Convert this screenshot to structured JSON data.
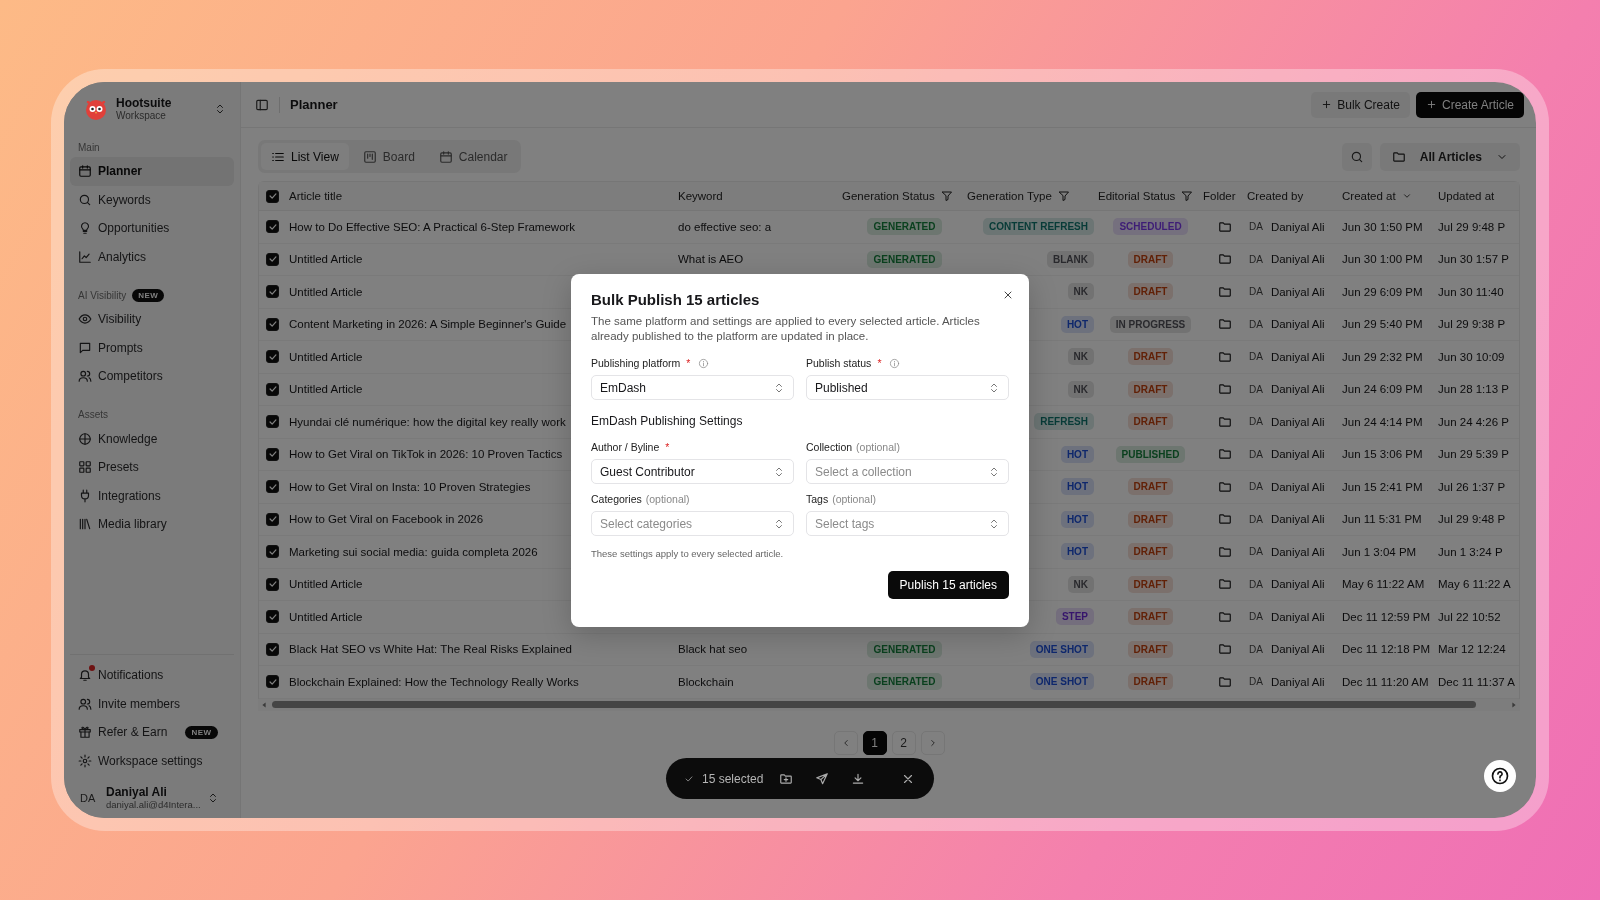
{
  "workspace": {
    "name": "Hootsuite",
    "subtitle": "Workspace"
  },
  "sidebar": {
    "sections": [
      {
        "label": "Main",
        "items": [
          {
            "label": "Planner",
            "selected": true
          },
          {
            "label": "Keywords",
            "selected": false
          },
          {
            "label": "Opportunities",
            "selected": false
          },
          {
            "label": "Analytics",
            "selected": false
          }
        ]
      },
      {
        "label": "AI Visibility",
        "badge": "NEW",
        "items": [
          {
            "label": "Visibility",
            "selected": false
          },
          {
            "label": "Prompts",
            "selected": false
          },
          {
            "label": "Competitors",
            "selected": false
          }
        ]
      },
      {
        "label": "Assets",
        "items": [
          {
            "label": "Knowledge",
            "selected": false
          },
          {
            "label": "Presets",
            "selected": false
          },
          {
            "label": "Integrations",
            "selected": false
          },
          {
            "label": "Media library",
            "selected": false
          }
        ]
      }
    ],
    "footer_items": [
      {
        "label": "Notifications",
        "alert": true
      },
      {
        "label": "Invite members",
        "alert": false
      },
      {
        "label": "Refer & Earn",
        "alert": false,
        "badge": "NEW"
      },
      {
        "label": "Workspace settings",
        "alert": false
      }
    ],
    "user": {
      "initials": "DA",
      "name": "Daniyal Ali",
      "email": "daniyal.ali@d4Intera..."
    }
  },
  "header": {
    "title": "Planner",
    "buttons": [
      {
        "label": "Bulk Create",
        "kind": "secondary"
      },
      {
        "label": "Create Article",
        "kind": "primary"
      }
    ]
  },
  "view_tabs": [
    {
      "label": "List View",
      "selected": true
    },
    {
      "label": "Board",
      "selected": false
    },
    {
      "label": "Calendar",
      "selected": false
    }
  ],
  "folder_filter": {
    "label": "All Articles"
  },
  "table": {
    "all_selected": true,
    "columns": [
      {
        "label": "Article title",
        "kind": "plain"
      },
      {
        "label": "Keyword",
        "kind": "plain"
      },
      {
        "label": "Generation Status",
        "kind": "filter"
      },
      {
        "label": "Generation Type",
        "kind": "filter"
      },
      {
        "label": "Editorial Status",
        "kind": "filter"
      },
      {
        "label": "Folder",
        "kind": "plain"
      },
      {
        "label": "Created by",
        "kind": "plain"
      },
      {
        "label": "Created at",
        "kind": "sort"
      },
      {
        "label": "Updated at",
        "kind": "plain"
      }
    ],
    "rows": [
      {
        "selected": true,
        "title": "How to Do Effective SEO: A Practical 6-Step Framework",
        "keyword": "do effective seo: a",
        "generation_status": {
          "text": "GENERATED",
          "color": "#0a401e"
        },
        "generation_type": {
          "text": "CONTENT REFRESH",
          "color": "#073b37"
        },
        "editorial_status": {
          "text": "SCHEDULED",
          "color": "#3e1d76"
        },
        "creator_initials": "DA",
        "creator": "Daniyal Ali",
        "created_at": "Jun 30 1:50 PM",
        "updated_at": "Jul 29 9:48 P"
      },
      {
        "selected": true,
        "title": "Untitled Article",
        "keyword": "What is AEO",
        "generation_status": {
          "text": "GENERATED",
          "color": "#0a401e"
        },
        "generation_type": {
          "text": "BLANK",
          "color": "#29292d"
        },
        "editorial_status": {
          "text": "DRAFT",
          "color": "#612006"
        },
        "creator_initials": "DA",
        "creator": "Daniyal Ali",
        "created_at": "Jun 30 1:00 PM",
        "updated_at": "Jun 30 1:57 P"
      },
      {
        "selected": true,
        "title": "Untitled Article",
        "generation_type": {
          "text": "NK",
          "color": "#29292d"
        },
        "editorial_status": {
          "text": "DRAFT",
          "color": "#612006"
        },
        "creator_initials": "DA",
        "creator": "Daniyal Ali",
        "created_at": "Jun 29 6:09 PM",
        "updated_at": "Jun 30 11:40"
      },
      {
        "selected": true,
        "title": "Content Marketing in 2026: A Simple Beginner's Guide",
        "generation_type": {
          "text": "HOT",
          "color": "#0e276c"
        },
        "editorial_status": {
          "text": "IN PROGRESS",
          "color": "#29292d"
        },
        "creator_initials": "DA",
        "creator": "Daniyal Ali",
        "created_at": "Jun 29 5:40 PM",
        "updated_at": "Jul 29 9:38 P"
      },
      {
        "selected": true,
        "title": "Untitled Article",
        "generation_type": {
          "text": "NK",
          "color": "#29292d"
        },
        "editorial_status": {
          "text": "DRAFT",
          "color": "#612006"
        },
        "creator_initials": "DA",
        "creator": "Daniyal Ali",
        "created_at": "Jun 29 2:32 PM",
        "updated_at": "Jun 30 10:09"
      },
      {
        "selected": true,
        "title": "Untitled Article",
        "generation_type": {
          "text": "NK",
          "color": "#29292d"
        },
        "editorial_status": {
          "text": "DRAFT",
          "color": "#612006"
        },
        "creator_initials": "DA",
        "creator": "Daniyal Ali",
        "created_at": "Jun 24 6:09 PM",
        "updated_at": "Jun 28 1:13 P"
      },
      {
        "selected": true,
        "title": "Hyundai clé numérique: how the digital key really work",
        "generation_type": {
          "text": "REFRESH",
          "color": "#073b37"
        },
        "editorial_status": {
          "text": "DRAFT",
          "color": "#612006"
        },
        "creator_initials": "DA",
        "creator": "Daniyal Ali",
        "created_at": "Jun 24 4:14 PM",
        "updated_at": "Jun 24 4:26 P"
      },
      {
        "selected": true,
        "title": "How to Get Viral on TikTok in 2026: 10 Proven Tactics",
        "generation_type": {
          "text": "HOT",
          "color": "#0e276c"
        },
        "editorial_status": {
          "text": "PUBLISHED",
          "color": "#0a401e"
        },
        "creator_initials": "DA",
        "creator": "Daniyal Ali",
        "created_at": "Jun 15 3:06 PM",
        "updated_at": "Jun 29 5:39 P"
      },
      {
        "selected": true,
        "title": "How to Get Viral on Insta: 10 Proven Strategies",
        "generation_type": {
          "text": "HOT",
          "color": "#0e276c"
        },
        "editorial_status": {
          "text": "DRAFT",
          "color": "#612006"
        },
        "creator_initials": "DA",
        "creator": "Daniyal Ali",
        "created_at": "Jun 15 2:41 PM",
        "updated_at": "Jul 26 1:37 P"
      },
      {
        "selected": true,
        "title": "How to Get Viral on Facebook in 2026",
        "generation_type": {
          "text": "HOT",
          "color": "#0e276c"
        },
        "editorial_status": {
          "text": "DRAFT",
          "color": "#612006"
        },
        "creator_initials": "DA",
        "creator": "Daniyal Ali",
        "created_at": "Jun 11 5:31 PM",
        "updated_at": "Jul 29 9:48 P"
      },
      {
        "selected": true,
        "title": "Marketing sui social media: guida completa 2026",
        "generation_type": {
          "text": "HOT",
          "color": "#0e276c"
        },
        "editorial_status": {
          "text": "DRAFT",
          "color": "#612006"
        },
        "creator_initials": "DA",
        "creator": "Daniyal Ali",
        "created_at": "Jun 1 3:04 PM",
        "updated_at": "Jun 1 3:24 P"
      },
      {
        "selected": true,
        "title": "Untitled Article",
        "generation_type": {
          "text": "NK",
          "color": "#29292d"
        },
        "editorial_status": {
          "text": "DRAFT",
          "color": "#612006"
        },
        "creator_initials": "DA",
        "creator": "Daniyal Ali",
        "created_at": "May 6 11:22 AM",
        "updated_at": "May 6 11:22 A"
      },
      {
        "selected": true,
        "title": "Untitled Article",
        "generation_type": {
          "text": "STEP",
          "color": "#36146c"
        },
        "editorial_status": {
          "text": "DRAFT",
          "color": "#612006"
        },
        "creator_initials": "DA",
        "creator": "Daniyal Ali",
        "created_at": "Dec 11 12:59 PM",
        "updated_at": "Jul 22 10:52"
      },
      {
        "selected": true,
        "title": "Black Hat SEO vs White Hat: The Real Risks Explained",
        "keyword": "Black hat seo",
        "generation_status": {
          "text": "GENERATED",
          "color": "#0a401e"
        },
        "generation_type": {
          "text": "ONE SHOT",
          "color": "#0e276c"
        },
        "editorial_status": {
          "text": "DRAFT",
          "color": "#612006"
        },
        "creator_initials": "DA",
        "creator": "Daniyal Ali",
        "created_at": "Dec 11 12:18 PM",
        "updated_at": "Mar 12 12:24"
      },
      {
        "selected": true,
        "title": "Blockchain Explained: How the Technology Really Works",
        "keyword": "Blockchain",
        "generation_status": {
          "text": "GENERATED",
          "color": "#0a401e"
        },
        "generation_type": {
          "text": "ONE SHOT",
          "color": "#0e276c"
        },
        "editorial_status": {
          "text": "DRAFT",
          "color": "#612006"
        },
        "creator_initials": "DA",
        "creator": "Daniyal Ali",
        "created_at": "Dec 11 11:20 AM",
        "updated_at": "Dec 11 11:37 A"
      }
    ]
  },
  "pagination": {
    "pages": [
      {
        "label": "1",
        "selected": true
      },
      {
        "label": "2",
        "selected": false
      }
    ]
  },
  "selection_bar": {
    "count_label": "15 selected"
  },
  "modal": {
    "title": "Bulk Publish 15 articles",
    "description": "The same platform and settings are applied to every selected article. Articles already published to the platform are updated in place.",
    "platform_fields": [
      {
        "label": "Publishing platform",
        "required_mark": "*",
        "info": true,
        "value": "EmDash"
      },
      {
        "label": "Publish status",
        "required_mark": "*",
        "info": true,
        "value": "Published"
      }
    ],
    "section_title": "EmDash Publishing Settings",
    "settings_fields": [
      {
        "label": "Author / Byline",
        "required_mark": "*",
        "info": false,
        "value": "Guest Contributor"
      },
      {
        "label": "Collection",
        "hint": "(optional)",
        "info": false,
        "placeholder": "Select a collection"
      },
      {
        "label": "Categories",
        "hint": "(optional)",
        "info": false,
        "placeholder": "Select categories"
      },
      {
        "label": "Tags",
        "hint": "(optional)",
        "info": false,
        "placeholder": "Select tags"
      }
    ],
    "note": "These settings apply to every selected article.",
    "submit_label": "Publish 15 articles"
  }
}
